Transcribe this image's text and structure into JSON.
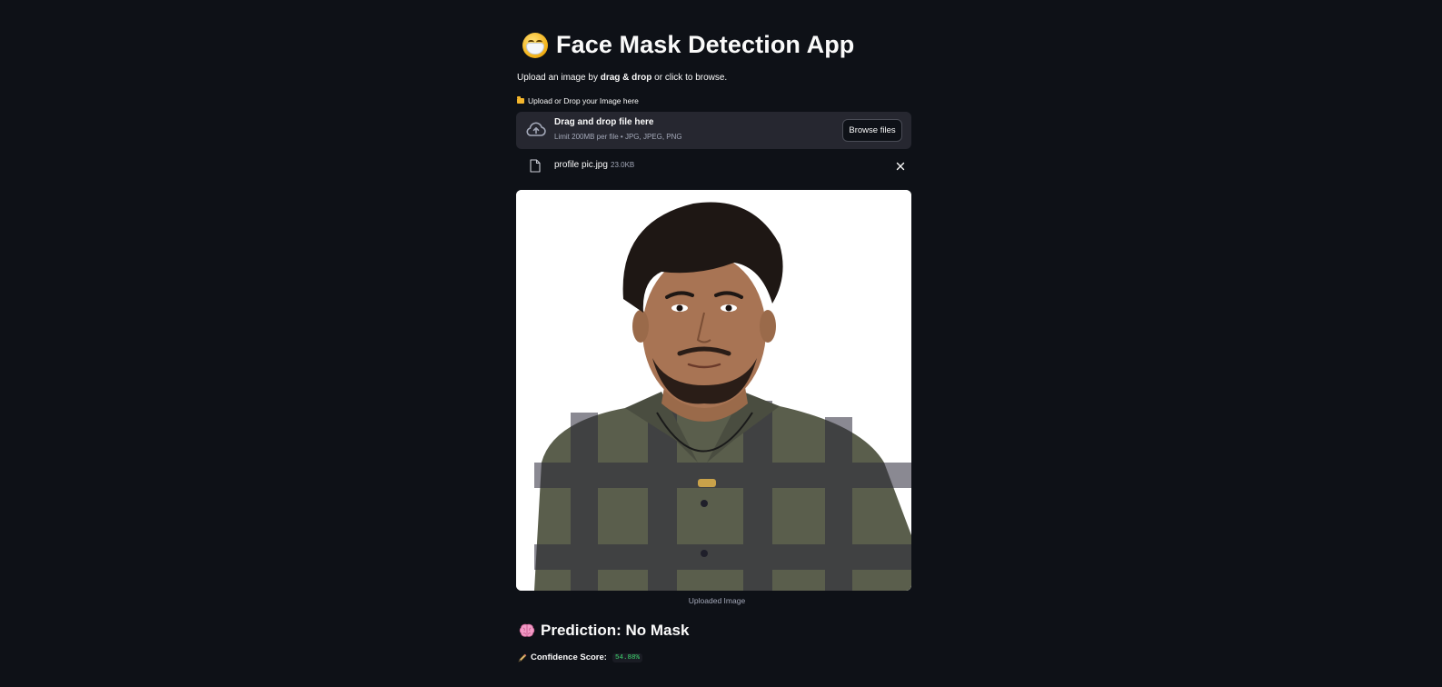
{
  "app": {
    "title": "Face Mask Detection App",
    "title_icon": "mask-face-emoji-icon"
  },
  "intro": {
    "prefix": "Upload an image by ",
    "emphasis": "drag & drop",
    "suffix": " or click to browse."
  },
  "uploader": {
    "label": "Upload or Drop your Image here",
    "label_icon": "folder-icon",
    "drop_title": "Drag and drop file here",
    "drop_limit": "Limit 200MB per file • JPG, JPEG, PNG",
    "browse_label": "Browse files"
  },
  "uploaded_file": {
    "name": "profile pic.jpg",
    "size": "23.0KB"
  },
  "image": {
    "caption": "Uploaded Image"
  },
  "result": {
    "prediction": "Prediction: No Mask",
    "prediction_icon": "brain-icon",
    "confidence_label": "Confidence Score:",
    "confidence_value": "54.88%",
    "confidence_icon": "pencil-icon"
  },
  "colors": {
    "background": "#0e1117",
    "panel": "#262730",
    "text": "#fafafa",
    "muted": "#a3a8b8",
    "accent_green": "#3dd56d"
  }
}
